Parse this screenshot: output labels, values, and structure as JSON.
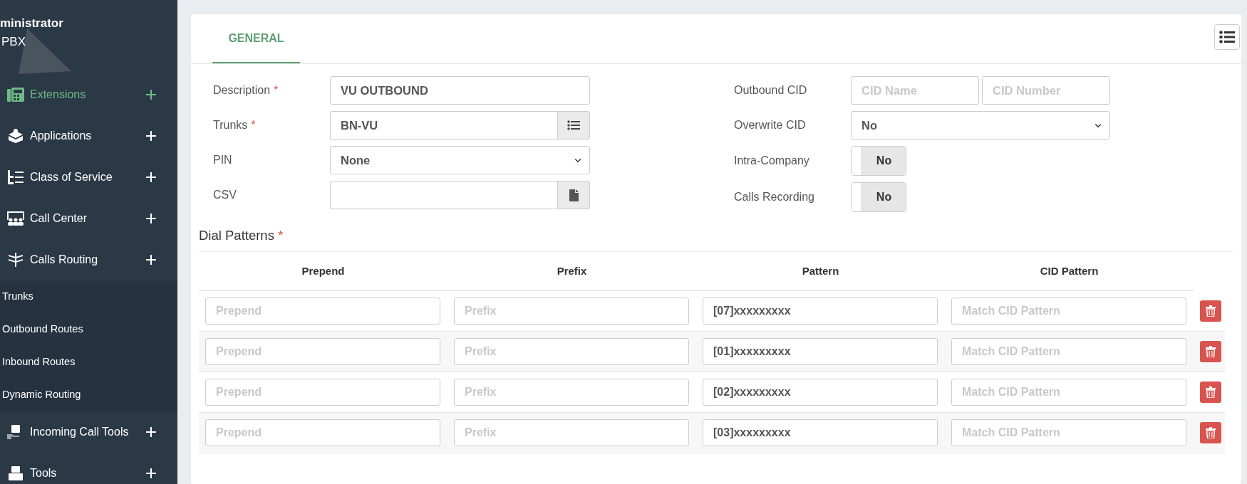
{
  "sidebar": {
    "user_name": "ministrator",
    "user_role": "PBX",
    "items": [
      {
        "label": "Extensions",
        "selected": true
      },
      {
        "label": "Applications",
        "selected": false
      },
      {
        "label": "Class of Service",
        "selected": false
      },
      {
        "label": "Call Center",
        "selected": false
      },
      {
        "label": "Calls Routing",
        "selected": false,
        "children": [
          {
            "label": "Trunks"
          },
          {
            "label": "Outbound Routes"
          },
          {
            "label": "Inbound Routes"
          },
          {
            "label": "Dynamic Routing"
          }
        ]
      },
      {
        "label": "Incoming Call Tools",
        "selected": false
      },
      {
        "label": "Tools",
        "selected": false
      }
    ]
  },
  "tabs": [
    {
      "label": "GENERAL",
      "selected": true
    }
  ],
  "form": {
    "left": [
      {
        "label": "Description",
        "required_mark": "*",
        "kind": "text",
        "value": "VU OUTBOUND"
      },
      {
        "label": "Trunks",
        "required_mark": "*",
        "kind": "picker",
        "value": "BN-VU"
      },
      {
        "label": "PIN",
        "kind": "select",
        "value": "None"
      },
      {
        "label": "CSV",
        "kind": "file"
      }
    ],
    "right": [
      {
        "label": "Outbound CID",
        "kind": "pair",
        "placeholders": [
          "CID Name",
          "CID Number"
        ]
      },
      {
        "label": "Overwrite CID",
        "kind": "select",
        "value": "No"
      },
      {
        "label": "Intra-Company",
        "kind": "toggle",
        "on": false,
        "value": "No"
      },
      {
        "label": "Calls Recording",
        "kind": "toggle",
        "on": false,
        "value": "No"
      }
    ]
  },
  "dial_patterns": {
    "title": "Dial Patterns",
    "required_mark": "*",
    "columns": [
      "Prepend",
      "Prefix",
      "Pattern",
      "CID Pattern"
    ],
    "rows": [
      {
        "cells": [
          {
            "placeholder": "Prepend"
          },
          {
            "placeholder": "Prefix"
          },
          {
            "value": "[07]xxxxxxxxx"
          },
          {
            "placeholder": "Match CID Pattern"
          }
        ]
      },
      {
        "cells": [
          {
            "placeholder": "Prepend"
          },
          {
            "placeholder": "Prefix"
          },
          {
            "value": "[01]xxxxxxxxx"
          },
          {
            "placeholder": "Match CID Pattern"
          }
        ]
      },
      {
        "cells": [
          {
            "placeholder": "Prepend"
          },
          {
            "placeholder": "Prefix"
          },
          {
            "value": "[02]xxxxxxxxx"
          },
          {
            "placeholder": "Match CID Pattern"
          }
        ]
      },
      {
        "cells": [
          {
            "placeholder": "Prepend"
          },
          {
            "placeholder": "Prefix"
          },
          {
            "value": "[03]xxxxxxxxx"
          },
          {
            "placeholder": "Match CID Pattern"
          }
        ]
      }
    ]
  }
}
